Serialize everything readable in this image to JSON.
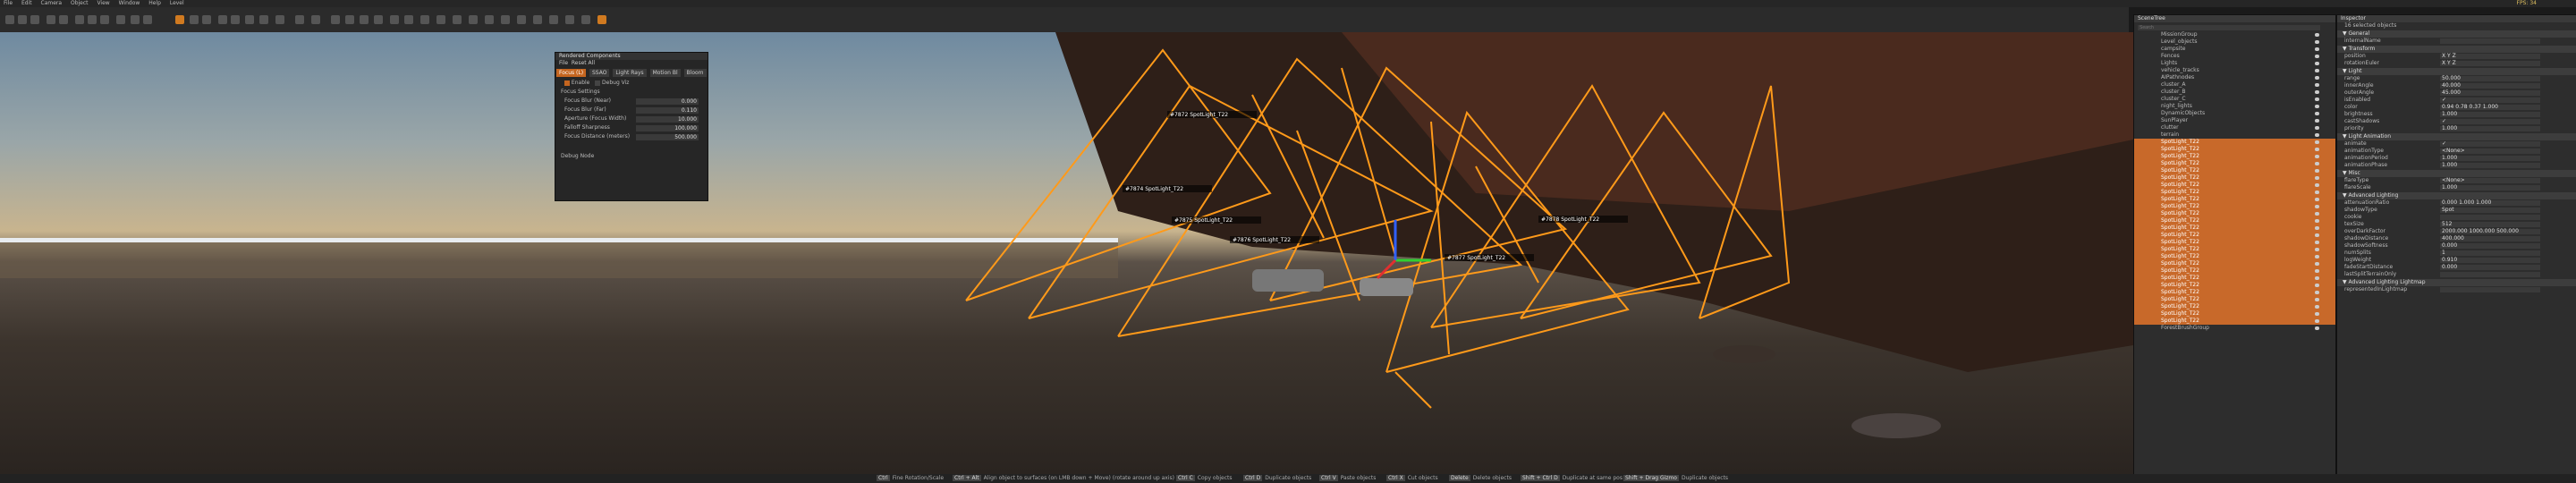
{
  "menubar": {
    "items": [
      "File",
      "Edit",
      "Camera",
      "Object",
      "View",
      "Window",
      "Help",
      "Level"
    ],
    "fps": "FPS: 34"
  },
  "viewport": {
    "light_labels": [
      "#7872 SpotLight_T22",
      "#7874 SpotLight_T22",
      "#7875 SpotLight_T22",
      "#7876 SpotLight_T22",
      "#7877 SpotLight_T22",
      "#7878 SpotLight_T22"
    ]
  },
  "render_window": {
    "title": "Rendered Components",
    "menu": [
      "File",
      "Reset All"
    ],
    "tabs": [
      "Focus (L)",
      "SSAO",
      "Light Rays",
      "Motion Bl",
      "Bloom"
    ],
    "active_tab": "Focus (L)",
    "enable_label": "Enable",
    "debug_label": "Debug Viz",
    "section": "Focus Settings",
    "rows": [
      {
        "label": "Focus Blur (Near)",
        "value": "0.000"
      },
      {
        "label": "Focus Blur (Far)",
        "value": "0.110"
      },
      {
        "label": "Aperture (Focus Width)",
        "value": "10.000"
      },
      {
        "label": "Falloff Sharpness",
        "value": "100.000"
      },
      {
        "label": "Focus Distance (meters)",
        "value": "500.000"
      }
    ],
    "footer": "Debug Node"
  },
  "scene_tree": {
    "title": "SceneTree",
    "search_placeholder": "Search",
    "items": [
      {
        "name": "MissionGroup",
        "selected": false
      },
      {
        "name": "Level_objects",
        "selected": false
      },
      {
        "name": "campsite",
        "selected": false
      },
      {
        "name": "Fences",
        "selected": false
      },
      {
        "name": "Lights",
        "selected": false
      },
      {
        "name": "vehicle_tracks",
        "selected": false
      },
      {
        "name": "AIPathnodes",
        "selected": false
      },
      {
        "name": "cluster_A",
        "selected": false
      },
      {
        "name": "cluster_B",
        "selected": false
      },
      {
        "name": "cluster_C",
        "selected": false
      },
      {
        "name": "night_lights",
        "selected": false
      },
      {
        "name": "DynamicObjects",
        "selected": false
      },
      {
        "name": "SunPlayer",
        "selected": false
      },
      {
        "name": "clutter",
        "selected": false
      },
      {
        "name": "terrain",
        "selected": false
      },
      {
        "name": "SpotLight_T22",
        "selected": true
      },
      {
        "name": "SpotLight_T22",
        "selected": true
      },
      {
        "name": "SpotLight_T22",
        "selected": true
      },
      {
        "name": "SpotLight_T22",
        "selected": true
      },
      {
        "name": "SpotLight_T22",
        "selected": true
      },
      {
        "name": "SpotLight_T22",
        "selected": true
      },
      {
        "name": "SpotLight_T22",
        "selected": true
      },
      {
        "name": "SpotLight_T22",
        "selected": true
      },
      {
        "name": "SpotLight_T22",
        "selected": true
      },
      {
        "name": "SpotLight_T22",
        "selected": true
      },
      {
        "name": "SpotLight_T22",
        "selected": true
      },
      {
        "name": "SpotLight_T22",
        "selected": true
      },
      {
        "name": "SpotLight_T22",
        "selected": true
      },
      {
        "name": "SpotLight_T22",
        "selected": true
      },
      {
        "name": "SpotLight_T22",
        "selected": true
      },
      {
        "name": "SpotLight_T22",
        "selected": true
      },
      {
        "name": "SpotLight_T22",
        "selected": true
      },
      {
        "name": "SpotLight_T22",
        "selected": true
      },
      {
        "name": "SpotLight_T22",
        "selected": true
      },
      {
        "name": "SpotLight_T22",
        "selected": true
      },
      {
        "name": "SpotLight_T22",
        "selected": true
      },
      {
        "name": "SpotLight_T22",
        "selected": true
      },
      {
        "name": "SpotLight_T22",
        "selected": true
      },
      {
        "name": "SpotLight_T22",
        "selected": true
      },
      {
        "name": "SpotLight_T22",
        "selected": true
      },
      {
        "name": "SpotLight_T22",
        "selected": true
      },
      {
        "name": "ForestBrushGroup",
        "selected": false
      }
    ]
  },
  "inspector": {
    "title": "Inspector",
    "subtitle": "16 selected objects",
    "sections": [
      {
        "name": "General",
        "rows": [
          {
            "label": "internalName",
            "value": ""
          }
        ]
      },
      {
        "name": "Transform",
        "rows": [
          {
            "label": "position",
            "value": "X  Y  Z"
          },
          {
            "label": "rotationEuler",
            "value": "X  Y  Z"
          }
        ]
      },
      {
        "name": "Light",
        "rows": [
          {
            "label": "range",
            "value": "50.000"
          },
          {
            "label": "innerAngle",
            "value": "40.000"
          },
          {
            "label": "outerAngle",
            "value": "45.000"
          },
          {
            "label": "isEnabled",
            "value": "✓"
          },
          {
            "label": "color",
            "value": "0.94  0.78  0.37  1.000"
          },
          {
            "label": "brightness",
            "value": "1.000"
          },
          {
            "label": "castShadows",
            "value": "✓"
          },
          {
            "label": "priority",
            "value": "1.000"
          }
        ]
      },
      {
        "name": "Light Animation",
        "rows": [
          {
            "label": "animate",
            "value": "✓"
          },
          {
            "label": "animationType",
            "value": "<None>"
          },
          {
            "label": "animationPeriod",
            "value": "1.000"
          },
          {
            "label": "animationPhase",
            "value": "1.000"
          }
        ]
      },
      {
        "name": "Misc",
        "rows": [
          {
            "label": "flareType",
            "value": "<None>"
          },
          {
            "label": "flareScale",
            "value": "1.000"
          }
        ]
      },
      {
        "name": "Advanced Lighting",
        "rows": [
          {
            "label": "attenuationRatio",
            "value": "0.000  1.000  1.000"
          },
          {
            "label": "shadowType",
            "value": "Spot"
          },
          {
            "label": "cookie",
            "value": ""
          },
          {
            "label": "texSize",
            "value": "512"
          },
          {
            "label": "overDarkFactor",
            "value": "2000.000  1000.000  500.000"
          },
          {
            "label": "shadowDistance",
            "value": "400.000"
          },
          {
            "label": "shadowSoftness",
            "value": "0.000"
          },
          {
            "label": "numSplits",
            "value": "1"
          },
          {
            "label": "logWeight",
            "value": "0.910"
          },
          {
            "label": "fadeStartDistance",
            "value": "0.000"
          },
          {
            "label": "lastSplitTerrainOnly",
            "value": ""
          }
        ]
      },
      {
        "name": "Advanced Lighting Lightmap",
        "rows": [
          {
            "label": "representedInLightmap",
            "value": ""
          }
        ]
      }
    ]
  },
  "statusbar": {
    "hints": [
      {
        "key": "Ctrl",
        "text": "Fine Rotation/Scale"
      },
      {
        "key": "Ctrl + Alt",
        "text": "Align object to surfaces (on LMB down + Move) (rotate around up axis)"
      },
      {
        "key": "Ctrl C",
        "text": "Copy objects"
      },
      {
        "key": "Ctrl D",
        "text": "Duplicate objects"
      },
      {
        "key": "Ctrl V",
        "text": "Paste objects"
      },
      {
        "key": "Ctrl X",
        "text": "Cut objects"
      },
      {
        "key": "Delete",
        "text": "Delete objects"
      },
      {
        "key": "Shift + Ctrl D",
        "text": "Duplicate at same pos"
      },
      {
        "key": "Shift + Drag Gizmo",
        "text": "Duplicate objects"
      }
    ]
  },
  "colors": {
    "accent": "#c8692a",
    "light_lines": "#ff9a1a"
  }
}
